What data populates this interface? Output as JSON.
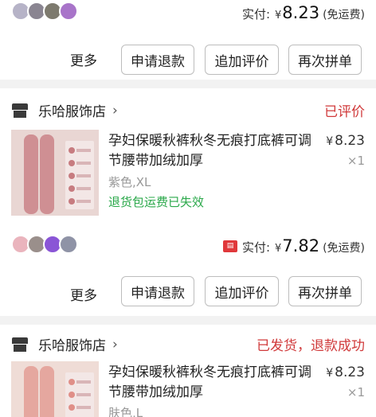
{
  "orders": [
    {
      "thumbnail_colors": [
        "#b6b3c7",
        "#8a8591",
        "#7d7a6e",
        "#a874c9"
      ],
      "payment": {
        "label": "实付:",
        "currency": "¥",
        "amount": "8.23",
        "shipping": "(免运费)"
      },
      "actions": {
        "more": "更多",
        "refund": "申请退款",
        "add_review": "追加评价",
        "rebuy": "再次拼单"
      }
    },
    {
      "store_name": "乐哈服饰店",
      "chevron": "›",
      "status": "已评价",
      "status_color": "#d0393a",
      "product": {
        "title": "孕妇保暖秋裤秋冬无痕打底裤可调节腰带加绒加厚",
        "currency": "¥",
        "price": "8.23",
        "quantity": "×1",
        "sku": "紫色,XL",
        "notice": "退货包运费已失效",
        "notice_color": "#2aa84a",
        "image_color": "#cf8f93"
      },
      "thumbnail_colors": [
        "#eab4bd",
        "#9a8f8b",
        "#8a55d6",
        "#8f93a6"
      ],
      "payment": {
        "tag_icon": "red-envelope-icon",
        "label": "实付:",
        "currency": "¥",
        "amount": "7.82",
        "shipping": "(免运费)"
      },
      "actions": {
        "more": "更多",
        "refund": "申请退款",
        "add_review": "追加评价",
        "rebuy": "再次拼单"
      }
    },
    {
      "store_name": "乐哈服饰店",
      "chevron": "›",
      "status": "已发货，退款成功",
      "status_color": "#d0393a",
      "product": {
        "title": "孕妇保暖秋裤秋冬无痕打底裤可调节腰带加绒加厚",
        "currency": "¥",
        "price": "8.23",
        "quantity": "×1",
        "sku": "肤色,L",
        "image_color": "#e5a79f"
      }
    }
  ]
}
